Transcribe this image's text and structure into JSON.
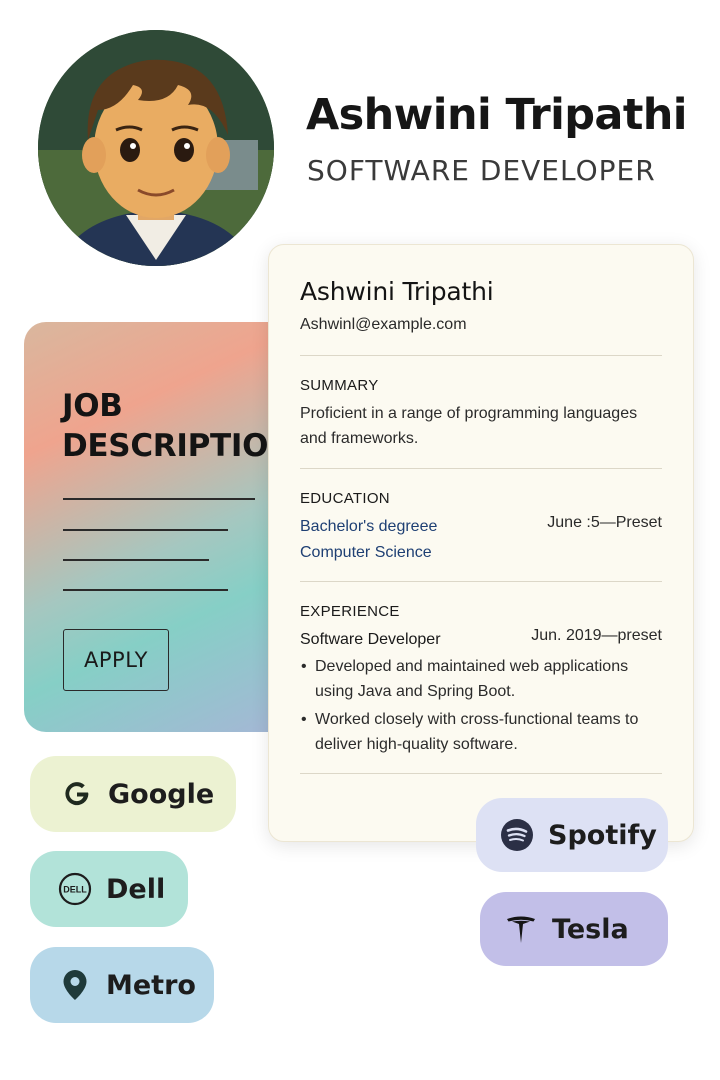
{
  "profile": {
    "name": "Ashwini Tripathi",
    "role": "SOFTWARE DEVELOPER"
  },
  "job_card": {
    "title": "JOB\nDESCRIPTION",
    "apply_label": "APPLY"
  },
  "resume": {
    "name": "Ashwini Tripathi",
    "email": "Ashwinl@example.com",
    "summary": {
      "heading": "SUMMARY",
      "text": "Proficient in a range of programming languages and frameworks."
    },
    "education": {
      "heading": "EDUCATION",
      "degree": "Bachelor's degreee",
      "field": "Computer Science",
      "date": "June :5—Preset"
    },
    "experience": {
      "heading": "EXPERIENCE",
      "role": "Software Developer",
      "date": "Jun. 2019—preset",
      "bullets": [
        "Developed and maintained web applications using Java and Spring Boot.",
        "Worked closely with cross-functional teams to deliver high-quality software."
      ]
    }
  },
  "companies": [
    {
      "name": "Google",
      "icon": "google-icon",
      "color": "#ecf2d2"
    },
    {
      "name": "Dell",
      "icon": "dell-icon",
      "icon_text": "DELL",
      "color": "#b2e3d9"
    },
    {
      "name": "Metro",
      "icon": "location-pin-icon",
      "color": "#b7d8e9"
    },
    {
      "name": "Spotify",
      "icon": "spotify-icon",
      "color": "#dde1f4"
    },
    {
      "name": "Tesla",
      "icon": "tesla-icon",
      "color": "#c2bfe8"
    }
  ]
}
